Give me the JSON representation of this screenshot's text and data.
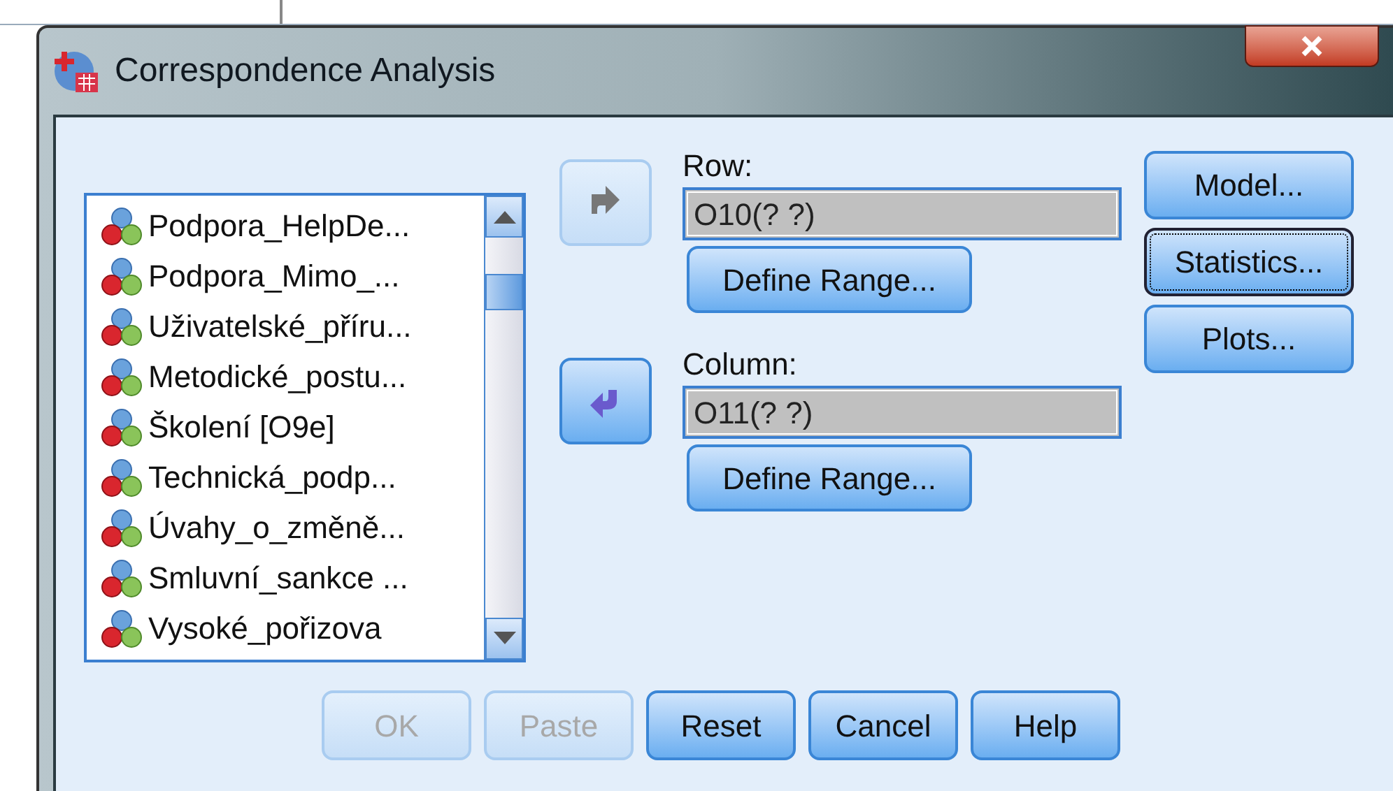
{
  "window": {
    "title": "Correspondence Analysis"
  },
  "variables": [
    {
      "label": "Podpora_HelpDe..."
    },
    {
      "label": "Podpora_Mimo_..."
    },
    {
      "label": "Uživatelské_příru..."
    },
    {
      "label": "Metodické_postu..."
    },
    {
      "label": "Školení [O9e]"
    },
    {
      "label": "Technická_podp..."
    },
    {
      "label": "Úvahy_o_změně..."
    },
    {
      "label": "Smluvní_sankce ..."
    },
    {
      "label": "Vysoké_pořizova"
    }
  ],
  "targets": [
    {
      "label": "Row:",
      "value": "O10(? ?)",
      "arrow_disabled": true,
      "kind": "right",
      "button": "Define Range..."
    },
    {
      "label": "Column:",
      "value": "O11(? ?)",
      "arrow_disabled": false,
      "kind": "left",
      "button": "Define Range..."
    }
  ],
  "side_buttons": [
    {
      "label": "Model...",
      "focused": false
    },
    {
      "label": "Statistics...",
      "focused": true
    },
    {
      "label": "Plots...",
      "focused": false
    }
  ],
  "buttons": [
    {
      "label": "OK",
      "disabled": true
    },
    {
      "label": "Paste",
      "disabled": true
    },
    {
      "label": "Reset",
      "disabled": false
    },
    {
      "label": "Cancel",
      "disabled": false
    },
    {
      "label": "Help",
      "disabled": false
    }
  ]
}
